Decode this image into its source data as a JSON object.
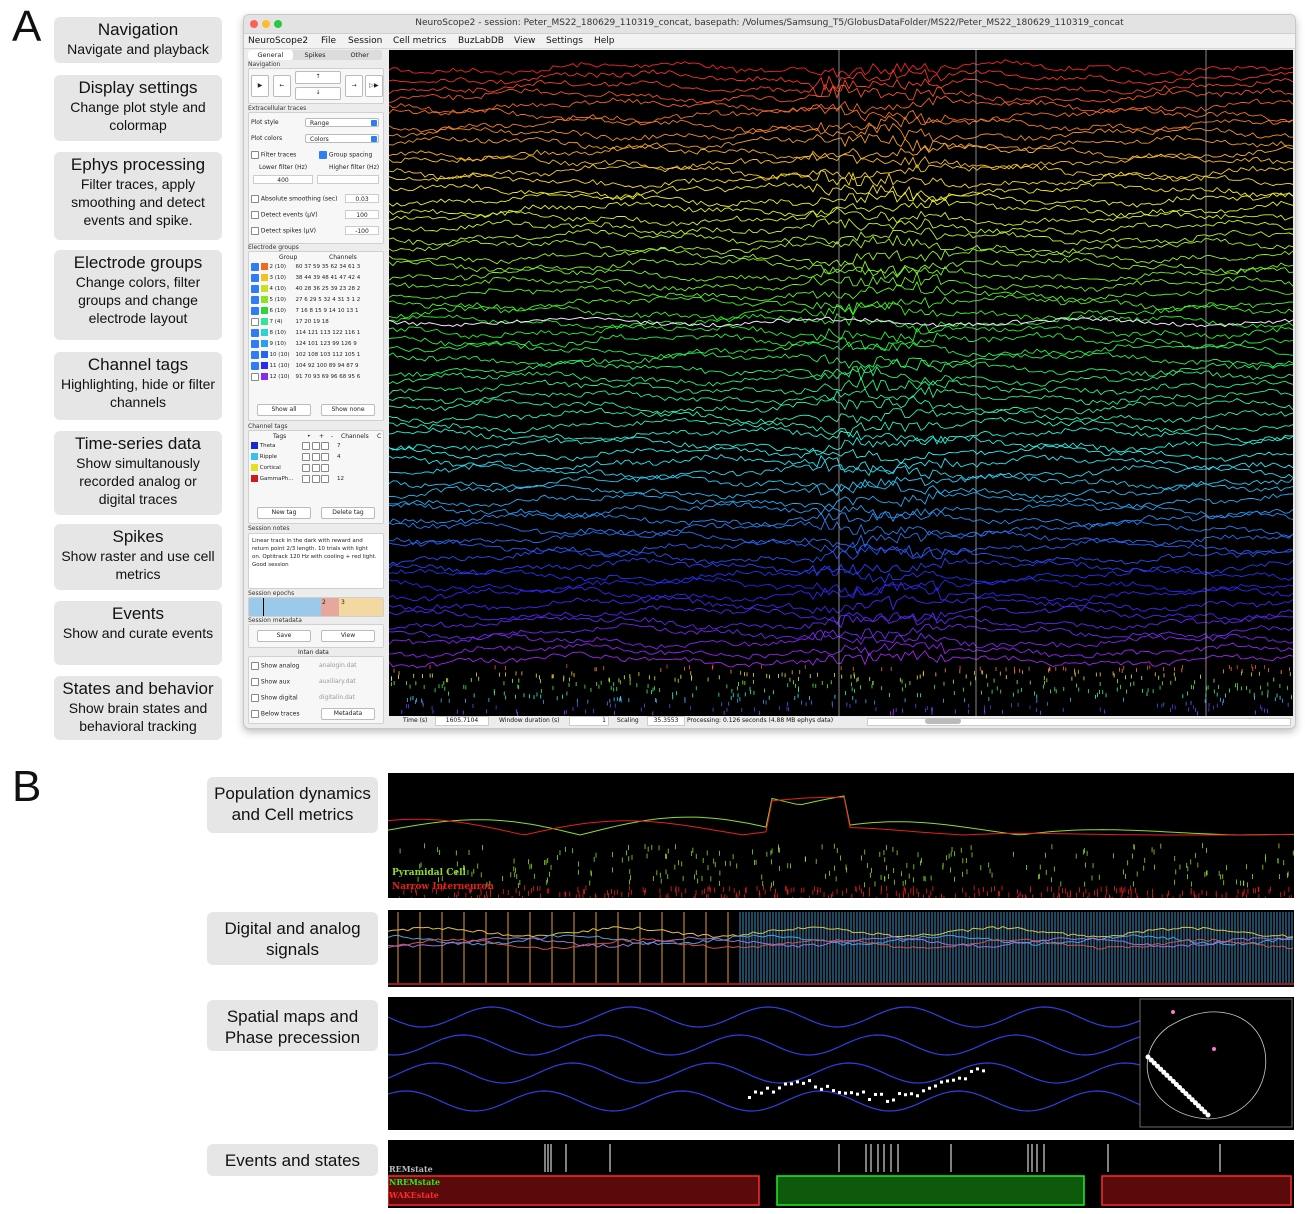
{
  "panels": {
    "a": "A",
    "b": "B"
  },
  "features": [
    {
      "title": "Navigation",
      "desc": "Navigate and playback"
    },
    {
      "title": "Display settings",
      "desc": "Change plot style and colormap"
    },
    {
      "title": "Ephys processing",
      "desc": "Filter traces, apply smoothing and detect events and spike."
    },
    {
      "title": "Electrode groups",
      "desc": "Change colors, filter groups and change electrode layout"
    },
    {
      "title": "Channel tags",
      "desc": "Highlighting, hide or filter channels"
    },
    {
      "title": "Time-series data",
      "desc": "Show simultanously recorded analog or digital traces"
    },
    {
      "title": "Spikes",
      "desc": "Show raster and use cell metrics"
    },
    {
      "title": "Events",
      "desc": "Show and curate events"
    },
    {
      "title": "States and behavior",
      "desc": "Show brain states and behavioral tracking"
    }
  ],
  "window": {
    "title": "NeuroScope2  -  session: Peter_MS22_180629_110319_concat, basepath: /Volumes/Samsung_T5/GlobusDataFolder/MS22/Peter_MS22_180629_110319_concat",
    "menu": [
      "NeuroScope2",
      "File",
      "Session",
      "Cell metrics",
      "BuzLabDB",
      "View",
      "Settings",
      "Help"
    ],
    "tabs": [
      "General",
      "Spikes",
      "Other"
    ],
    "navigation": {
      "label": "Navigation",
      "play": "▶",
      "back": "←",
      "up": "↑",
      "down": "↓",
      "forward": "→",
      "fast_forward": "▷▶"
    },
    "extracellular": {
      "label": "Extracellular traces",
      "plot_style_label": "Plot style",
      "plot_style_value": "Range",
      "plot_colors_label": "Plot colors",
      "plot_colors_value": "Colors",
      "filter_traces": "Filter traces",
      "group_spacing": "Group spacing",
      "lower_filter": "Lower filter (Hz)",
      "higher_filter": "Higher filter (Hz)",
      "lower_value": "400",
      "higher_value": "",
      "abs_smoothing": "Absolute smoothing (sec)",
      "abs_smoothing_value": "0.03",
      "detect_events": "Detect events (μV)",
      "detect_events_value": "100",
      "detect_spikes": "Detect spikes (μV)",
      "detect_spikes_value": "-100"
    },
    "electrode_groups": {
      "label": "Electrode groups",
      "headers": [
        "Group",
        "Channels"
      ],
      "rows": [
        {
          "group": "2 (10)",
          "channels": "60 37 59 35 62 34 61 3",
          "color": "#f26b1d",
          "checked": true
        },
        {
          "group": "3 (10)",
          "channels": "38 44 39 48 41 47 42 4",
          "color": "#f5c21b",
          "checked": true
        },
        {
          "group": "4 (10)",
          "channels": "40 28 36 25 39 23 28 2",
          "color": "#c7e01f",
          "checked": true
        },
        {
          "group": "5 (10)",
          "channels": "27 6 29 5 32 4 31 3 1 2",
          "color": "#8de31f",
          "checked": true
        },
        {
          "group": "6 (10)",
          "channels": "7 16 8 15 9 14 10 13 1",
          "color": "#2fd63a",
          "checked": true
        },
        {
          "group": "7 (4)",
          "channels": "17 20 19 18",
          "color": "#35e39a",
          "checked": false
        },
        {
          "group": "8 (10)",
          "channels": "114 121 113 122 116 1",
          "color": "#2fd2d2",
          "checked": true
        },
        {
          "group": "9 (10)",
          "channels": "124 101 123 99 126 9",
          "color": "#2a9ff0",
          "checked": true
        },
        {
          "group": "10 (10)",
          "channels": "102 108 103 112 105 1",
          "color": "#2a62f0",
          "checked": true
        },
        {
          "group": "11 (10)",
          "channels": "104 92 100 89 94 87 9",
          "color": "#2a2af0",
          "checked": true
        },
        {
          "group": "12 (10)",
          "channels": "91 70 93 69 96 68 95 6",
          "color": "#8a2af0",
          "checked": false
        }
      ],
      "show_all": "Show all",
      "show_none": "Show none"
    },
    "channel_tags": {
      "label": "Channel tags",
      "headers": [
        "Tags",
        "•",
        "+",
        "-",
        "Channels",
        "C"
      ],
      "rows": [
        {
          "tag": "Theta",
          "channels": "7",
          "color": "#1a2ad0"
        },
        {
          "tag": "Ripple",
          "channels": "4",
          "color": "#3ac0ea"
        },
        {
          "tag": "Cortical",
          "channels": "",
          "color": "#e3e020"
        },
        {
          "tag": "GammaPh...",
          "channels": "12",
          "color": "#d01a1a"
        }
      ],
      "new_tag": "New tag",
      "delete_tag": "Delete tag"
    },
    "session_notes": {
      "label": "Session notes",
      "text": "Linear track in the dark with reward and return point 2/3 length. 10 trials with light on. Optitrack 120 Hz with cooling + red light. Good session"
    },
    "session_epochs": {
      "label": "Session epochs",
      "e2": "2",
      "e3": "3"
    },
    "session_metadata": {
      "label": "Session metadata",
      "save": "Save",
      "view": "View"
    },
    "intan": {
      "label": "Intan data",
      "show_analog": "Show analog",
      "analog_file": "analogin.dat",
      "show_aux": "Show aux",
      "aux_file": "auxiliary.dat",
      "show_digital": "Show digital",
      "digital_file": "digitalin.dat",
      "below_traces": "Below traces",
      "metadata": "Metadata"
    },
    "status": {
      "time_label": "Time (s)",
      "time_value": "1605.7104",
      "window_label": "Window duration (s)",
      "window_value": "1",
      "scaling_label": "Scaling",
      "scaling_value": "35.3553",
      "processing": "Processing: 0.126 seconds (4.88 MB ephys data)"
    }
  },
  "panel_b": {
    "labels": [
      "Population dynamics and Cell metrics",
      "Digital and analog signals",
      "Spatial maps and Phase precession",
      "Events and states"
    ],
    "legend_pyr": "Pyramidal Cell",
    "legend_int": "Narrow Interneuron",
    "states": {
      "rem": "REMstate",
      "nrem": "NREMstate",
      "wake": "WAKEstate"
    }
  },
  "colors": {
    "pyr": "#8fdd2a",
    "int": "#e8201a",
    "rem": "#bbbbbb",
    "nrem": "#22ee22",
    "wake": "#ff2b2b"
  }
}
